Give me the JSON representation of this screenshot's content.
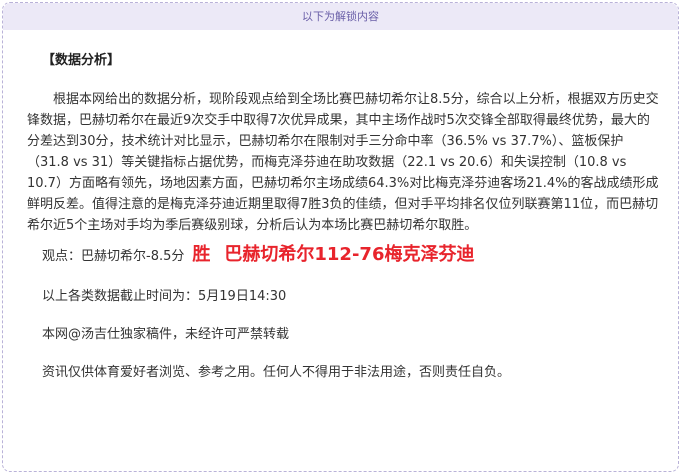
{
  "header": {
    "title": "以下为解锁内容"
  },
  "article": {
    "section_title": "【数据分析】",
    "analysis": "根据本网给出的数据分析，现阶段观点给到全场比赛巴赫切希尔让8.5分，综合以上分析，根据双方历史交锋数据，巴赫切希尔在最近9次交手中取得7次优异成果，其中主场作战时5次交锋全部取得最终优势，最大的分差达到30分，技术统计对比显示，巴赫切希尔在限制对手三分命中率（36.5% vs 37.7%）、篮板保护（31.8 vs 31）等关键指标占据优势，而梅克泽芬迪在助攻数据（22.1 vs 20.6）和失误控制（10.8 vs 10.7）方面略有领先，场地因素方面，巴赫切希尔主场成绩64.3%对比梅克泽芬迪客场21.4%的客战成绩形成鲜明反差。值得注意的是梅克泽芬迪近期里取得7胜3负的佳绩，但对手平均排名仅位列联赛第11位，而巴赫切希尔近5个主场对手均为季后赛级别球，分析后认为本场比赛巴赫切希尔取胜。",
    "viewpoint_label": "观点：巴赫切希尔-8.5分",
    "result_win": "胜",
    "result_score": "巴赫切希尔112-76梅克泽芬迪",
    "data_cutoff": "以上各类数据截止时间为：5月19日14:30",
    "copyright": "本网@汤吉仕独家稿件，未经许可严禁转载",
    "disclaimer": "资讯仅供体育爱好者浏览、参考之用。任何人不得用于非法用途，否则责任自负。"
  },
  "colors": {
    "header_bg": "#ece9f7",
    "header_text": "#6a5fa8",
    "border": "#b9b2d8",
    "result_red": "#e8242c"
  }
}
